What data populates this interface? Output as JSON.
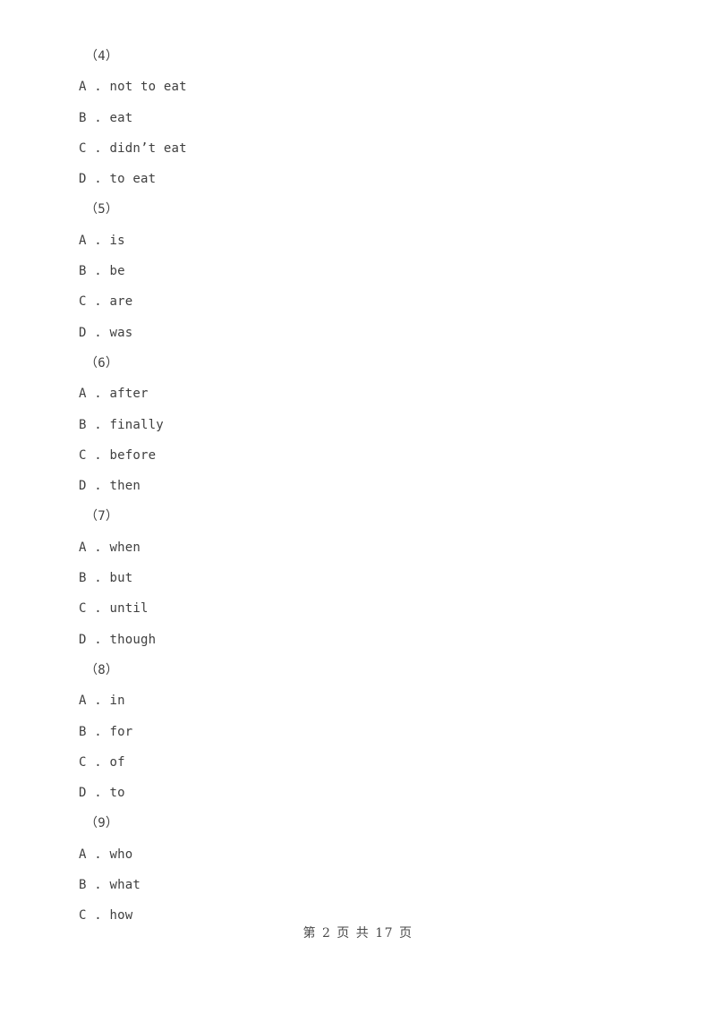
{
  "document": {
    "background_color": "#ffffff",
    "text_color": "#3f3f3f",
    "questions": [
      {
        "number": "（4）",
        "options": [
          "A . not to eat",
          "B . eat",
          "C . didn’t eat",
          "D . to eat"
        ]
      },
      {
        "number": "（5）",
        "options": [
          "A . is",
          "B . be",
          "C . are",
          "D . was"
        ]
      },
      {
        "number": "（6）",
        "options": [
          "A . after",
          "B . finally",
          "C . before",
          "D . then"
        ]
      },
      {
        "number": "（7）",
        "options": [
          "A . when",
          "B . but",
          "C . until",
          "D . though"
        ]
      },
      {
        "number": "（8）",
        "options": [
          "A . in",
          "B . for",
          "C . of",
          "D . to"
        ]
      },
      {
        "number": "（9）",
        "options": [
          "A . who",
          "B . what",
          "C . how"
        ]
      }
    ],
    "footer": {
      "text": "第 2 页 共 17 页",
      "current_page": "2",
      "total_pages": "17"
    }
  }
}
